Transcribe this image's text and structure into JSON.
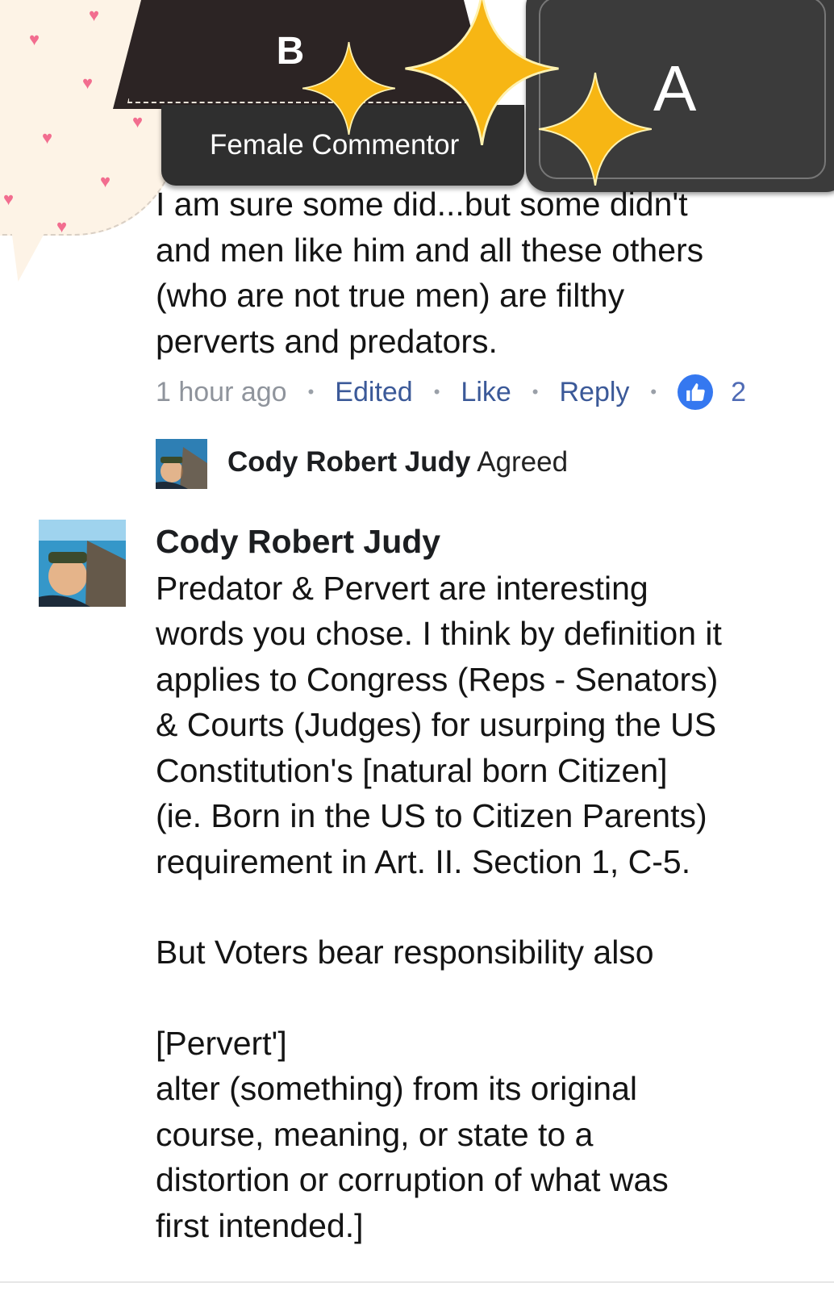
{
  "overlay": {
    "badge_b_letter": "B",
    "badge_a_letter": "A",
    "name_plate": "Female Commentor"
  },
  "first_comment": {
    "lines": [
      "I am sure some did...but some didn't",
      "and men like him and all these others",
      "(who are not true men) are filthy",
      "perverts and predators."
    ],
    "time": "1 hour ago",
    "edited": "Edited",
    "like": "Like",
    "reply": "Reply",
    "like_count": "2"
  },
  "reaction": {
    "name": "Cody Robert Judy",
    "action": "Agreed"
  },
  "reply_comment": {
    "author": "Cody Robert Judy",
    "lines": [
      "Predator & Pervert are interesting",
      "words you chose. I think by definition it",
      "applies to Congress (Reps - Senators)",
      "& Courts (Judges) for usurping the US",
      "Constitution's  [natural born Citizen]",
      "(ie. Born in the US to Citizen Parents)",
      "requirement in Art. II. Section 1, C-5.",
      "",
      "But Voters bear responsibility also",
      "",
      "[Pervert']",
      "alter (something) from its original",
      "course, meaning, or state to a",
      "distortion or corruption of what was",
      "first intended.]"
    ]
  },
  "colors": {
    "link": "#3b5998",
    "like_badge": "#3578f0",
    "sparkle": "#f7b614",
    "heart": "#f26d8f"
  }
}
